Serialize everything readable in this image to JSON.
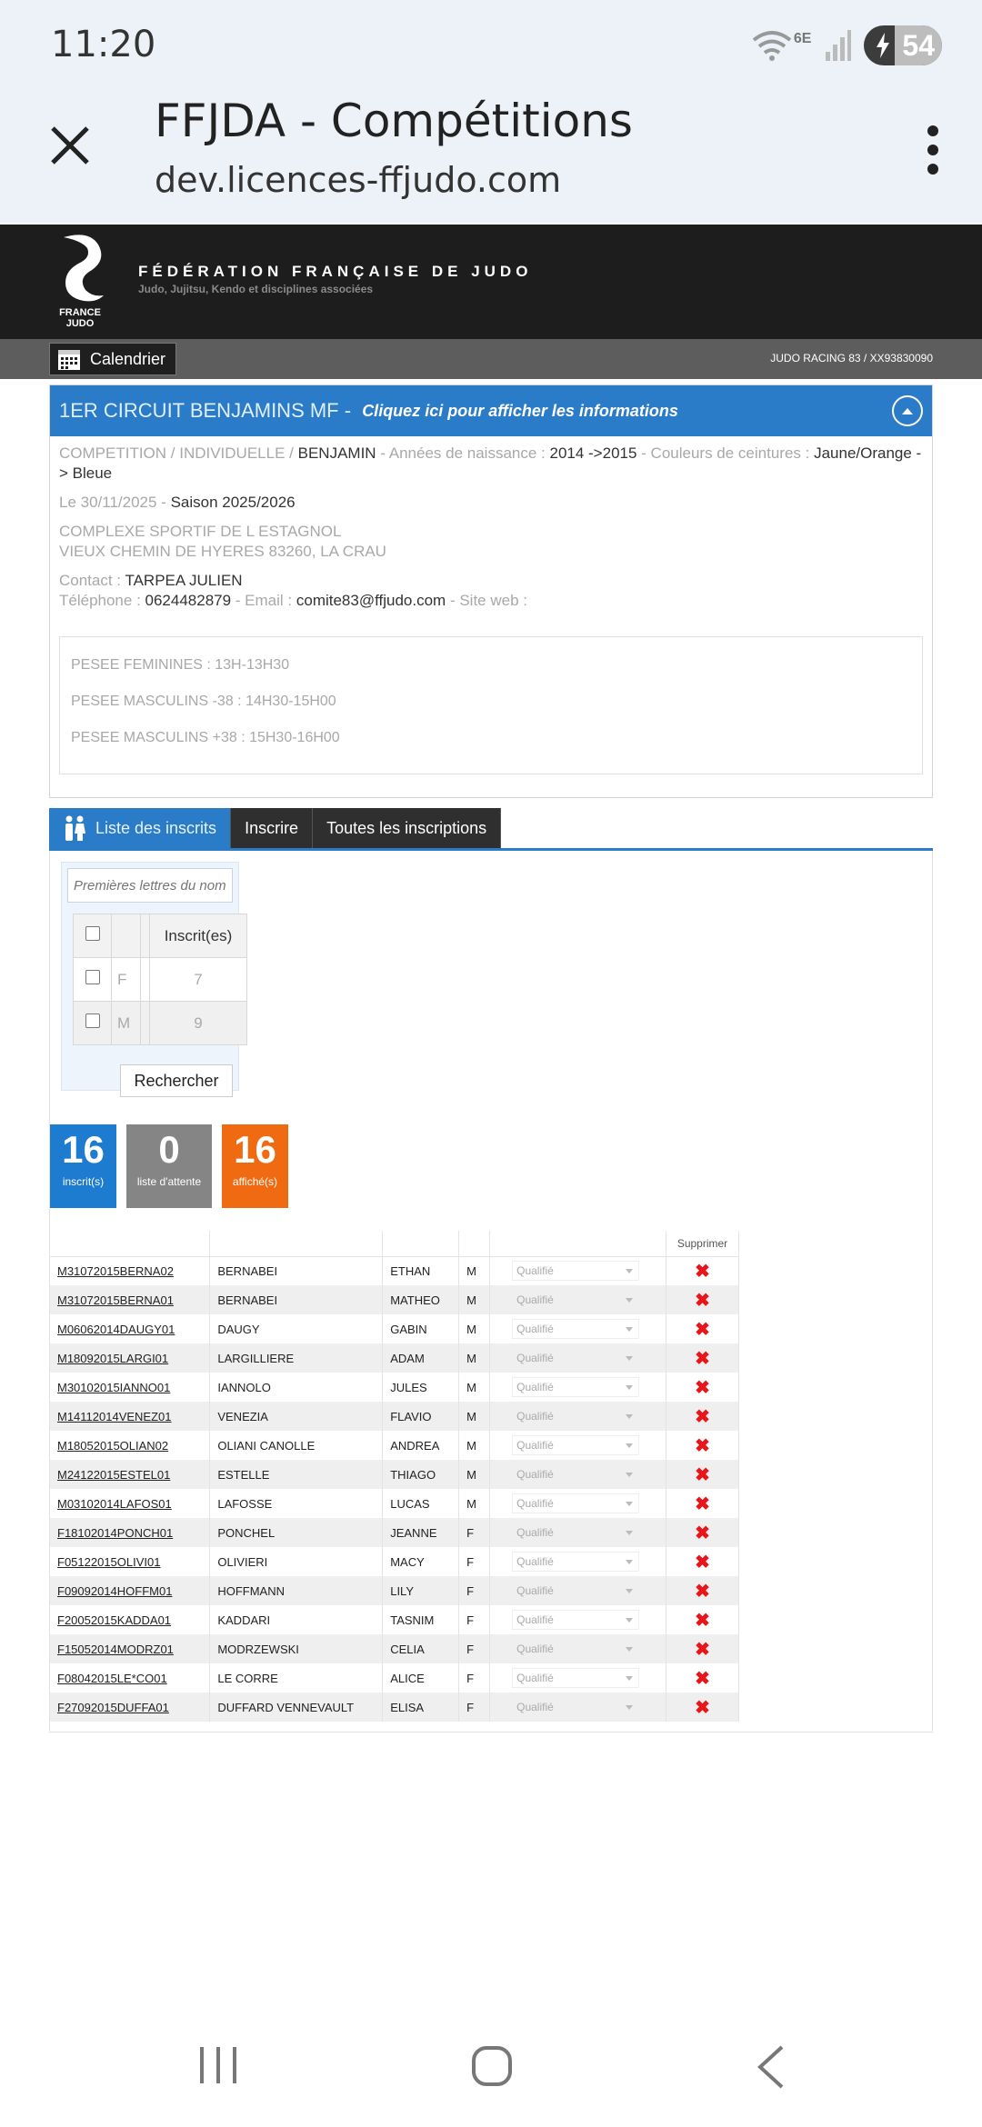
{
  "status": {
    "time": "11:20",
    "network": "6E",
    "battery": "54"
  },
  "browser": {
    "title": "FFJDA - Compétitions",
    "url": "dev.licences-ffjudo.com"
  },
  "site": {
    "logo_text": "FRANCE JUDO",
    "federation": "FÉDÉRATION FRANÇAISE DE JUDO",
    "subtitle": "Judo, Jujitsu, Kendo et disciplines associées",
    "calendar": "Calendrier",
    "club": "JUDO RACING 83 / XX93830090"
  },
  "competition": {
    "name": "1ER CIRCUIT BENJAMINS MF",
    "sep": " - ",
    "info_link": "Cliquez ici pour afficher les informations",
    "type_label": "COMPETITION / INDIVIDUELLE / ",
    "category": "BENJAMIN",
    "years_label": " - Années de naissance : ",
    "years": "2014 ->2015",
    "belts_label": " - Couleurs de ceintures : ",
    "belts": "Jaune/Orange -> Bleue",
    "date": "Le 30/11/2025 - ",
    "season": "Saison 2025/2026",
    "venue": "COMPLEXE SPORTIF DE L ESTAGNOL",
    "address": "VIEUX CHEMIN DE HYERES 83260, LA CRAU",
    "contact_label": "Contact : ",
    "contact": "TARPEA JULIEN",
    "phone_label": "Téléphone : ",
    "phone": "0624482879",
    "email_label": " - Email : ",
    "email": "comite83@ffjudo.com",
    "web_label": " - Site web :",
    "notes": [
      "PESEE FEMININES : 13H-13H30",
      "PESEE MASCULINS -38 : 14H30-15H00",
      "PESEE MASCULINS +38 : 15H30-16H00"
    ]
  },
  "tabs": [
    "Liste des inscrits",
    "Inscrire",
    "Toutes les inscriptions"
  ],
  "filter": {
    "placeholder": "Premières lettres du nom",
    "header": "Inscrit(es)",
    "rows": [
      {
        "sex": "F",
        "count": "7"
      },
      {
        "sex": "M",
        "count": "9"
      }
    ],
    "search": "Rechercher"
  },
  "counters": [
    {
      "value": "16",
      "label": "inscrit(s)",
      "color": "#1d7bd0"
    },
    {
      "value": "0",
      "label": "liste d'attente",
      "color": "#858585"
    },
    {
      "value": "16",
      "label": "affiché(s)",
      "color": "#ef6a10"
    }
  ],
  "results": {
    "delete_header": "Supprimer",
    "status_value": "Qualifié",
    "rows": [
      {
        "code": "M31072015BERNA02",
        "last": "BERNABEI",
        "first": "ETHAN",
        "sex": "M"
      },
      {
        "code": "M31072015BERNA01",
        "last": "BERNABEI",
        "first": "MATHEO",
        "sex": "M"
      },
      {
        "code": "M06062014DAUGY01",
        "last": "DAUGY",
        "first": "GABIN",
        "sex": "M"
      },
      {
        "code": "M18092015LARGI01",
        "last": "LARGILLIERE",
        "first": "ADAM",
        "sex": "M"
      },
      {
        "code": "M30102015IANNO01",
        "last": "IANNOLO",
        "first": "JULES",
        "sex": "M"
      },
      {
        "code": "M14112014VENEZ01",
        "last": "VENEZIA",
        "first": "FLAVIO",
        "sex": "M"
      },
      {
        "code": "M18052015OLIAN02",
        "last": "OLIANI CANOLLE",
        "first": "ANDREA",
        "sex": "M"
      },
      {
        "code": "M24122015ESTEL01",
        "last": "ESTELLE",
        "first": "THIAGO",
        "sex": "M"
      },
      {
        "code": "M03102014LAFOS01",
        "last": "LAFOSSE",
        "first": "LUCAS",
        "sex": "M"
      },
      {
        "code": "F18102014PONCH01",
        "last": "PONCHEL",
        "first": "JEANNE",
        "sex": "F"
      },
      {
        "code": "F05122015OLIVI01",
        "last": "OLIVIERI",
        "first": "MACY",
        "sex": "F"
      },
      {
        "code": "F09092014HOFFM01",
        "last": "HOFFMANN",
        "first": "LILY",
        "sex": "F"
      },
      {
        "code": "F20052015KADDA01",
        "last": "KADDARI",
        "first": "TASNIM",
        "sex": "F"
      },
      {
        "code": "F15052014MODRZ01",
        "last": "MODRZEWSKI",
        "first": "CELIA",
        "sex": "F"
      },
      {
        "code": "F08042015LE*CO01",
        "last": "LE CORRE",
        "first": "ALICE",
        "sex": "F"
      },
      {
        "code": "F27092015DUFFA01",
        "last": "DUFFARD VENNEVAULT",
        "first": "ELISA",
        "sex": "F"
      }
    ]
  }
}
